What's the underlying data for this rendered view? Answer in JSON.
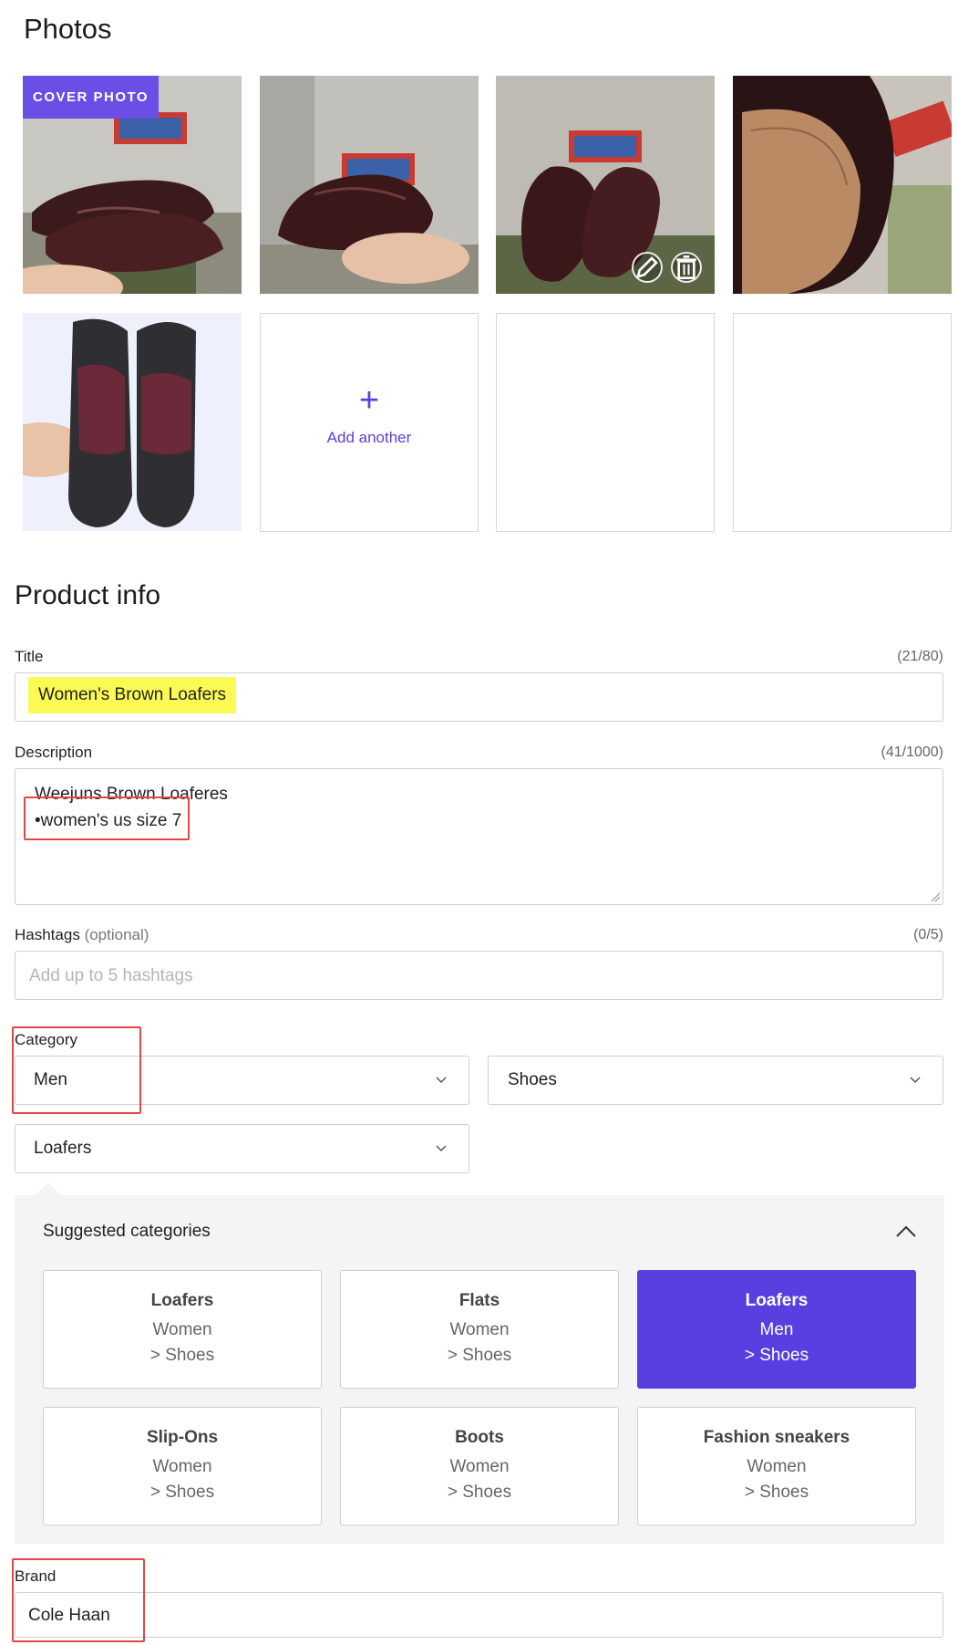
{
  "photos": {
    "heading": "Photos",
    "cover_badge": "COVER PHOTO",
    "add_another": "Add another",
    "items": [
      {
        "alt": "loafers held in hand, side view"
      },
      {
        "alt": "single loafer held in hand"
      },
      {
        "alt": "pair of loafers, front view"
      },
      {
        "alt": "loafer interior insole close-up"
      },
      {
        "alt": "loafer soles"
      }
    ]
  },
  "product_info": {
    "heading": "Product info",
    "title": {
      "label": "Title",
      "count": "(21/80)",
      "value": "Women's Brown Loafers"
    },
    "description": {
      "label": "Description",
      "count": "(41/1000)",
      "line1": "Weejuns Brown Loaferes",
      "line2": "•women's us size 7"
    },
    "hashtags": {
      "label": "Hashtags",
      "optional": "(optional)",
      "count": "(0/5)",
      "placeholder": "Add up to 5 hashtags"
    },
    "category": {
      "label": "Category",
      "level1": "Men",
      "level2": "Shoes",
      "level3": "Loafers"
    },
    "suggested": {
      "title": "Suggested categories",
      "tiles": [
        {
          "name": "Loafers",
          "line1": "Women",
          "line2": "> Shoes",
          "active": false
        },
        {
          "name": "Flats",
          "line1": "Women",
          "line2": "> Shoes",
          "active": false
        },
        {
          "name": "Loafers",
          "line1": "Men",
          "line2": "> Shoes",
          "active": true
        },
        {
          "name": "Slip-Ons",
          "line1": "Women",
          "line2": "> Shoes",
          "active": false
        },
        {
          "name": "Boots",
          "line1": "Women",
          "line2": "> Shoes",
          "active": false
        },
        {
          "name": "Fashion sneakers",
          "line1": "Women",
          "line2": "> Shoes",
          "active": false
        }
      ]
    },
    "brand": {
      "label": "Brand",
      "value": "Cole Haan"
    }
  },
  "colors": {
    "accent": "#5a3fe0",
    "highlight": "#fbfa55",
    "annotation": "#e04848"
  }
}
